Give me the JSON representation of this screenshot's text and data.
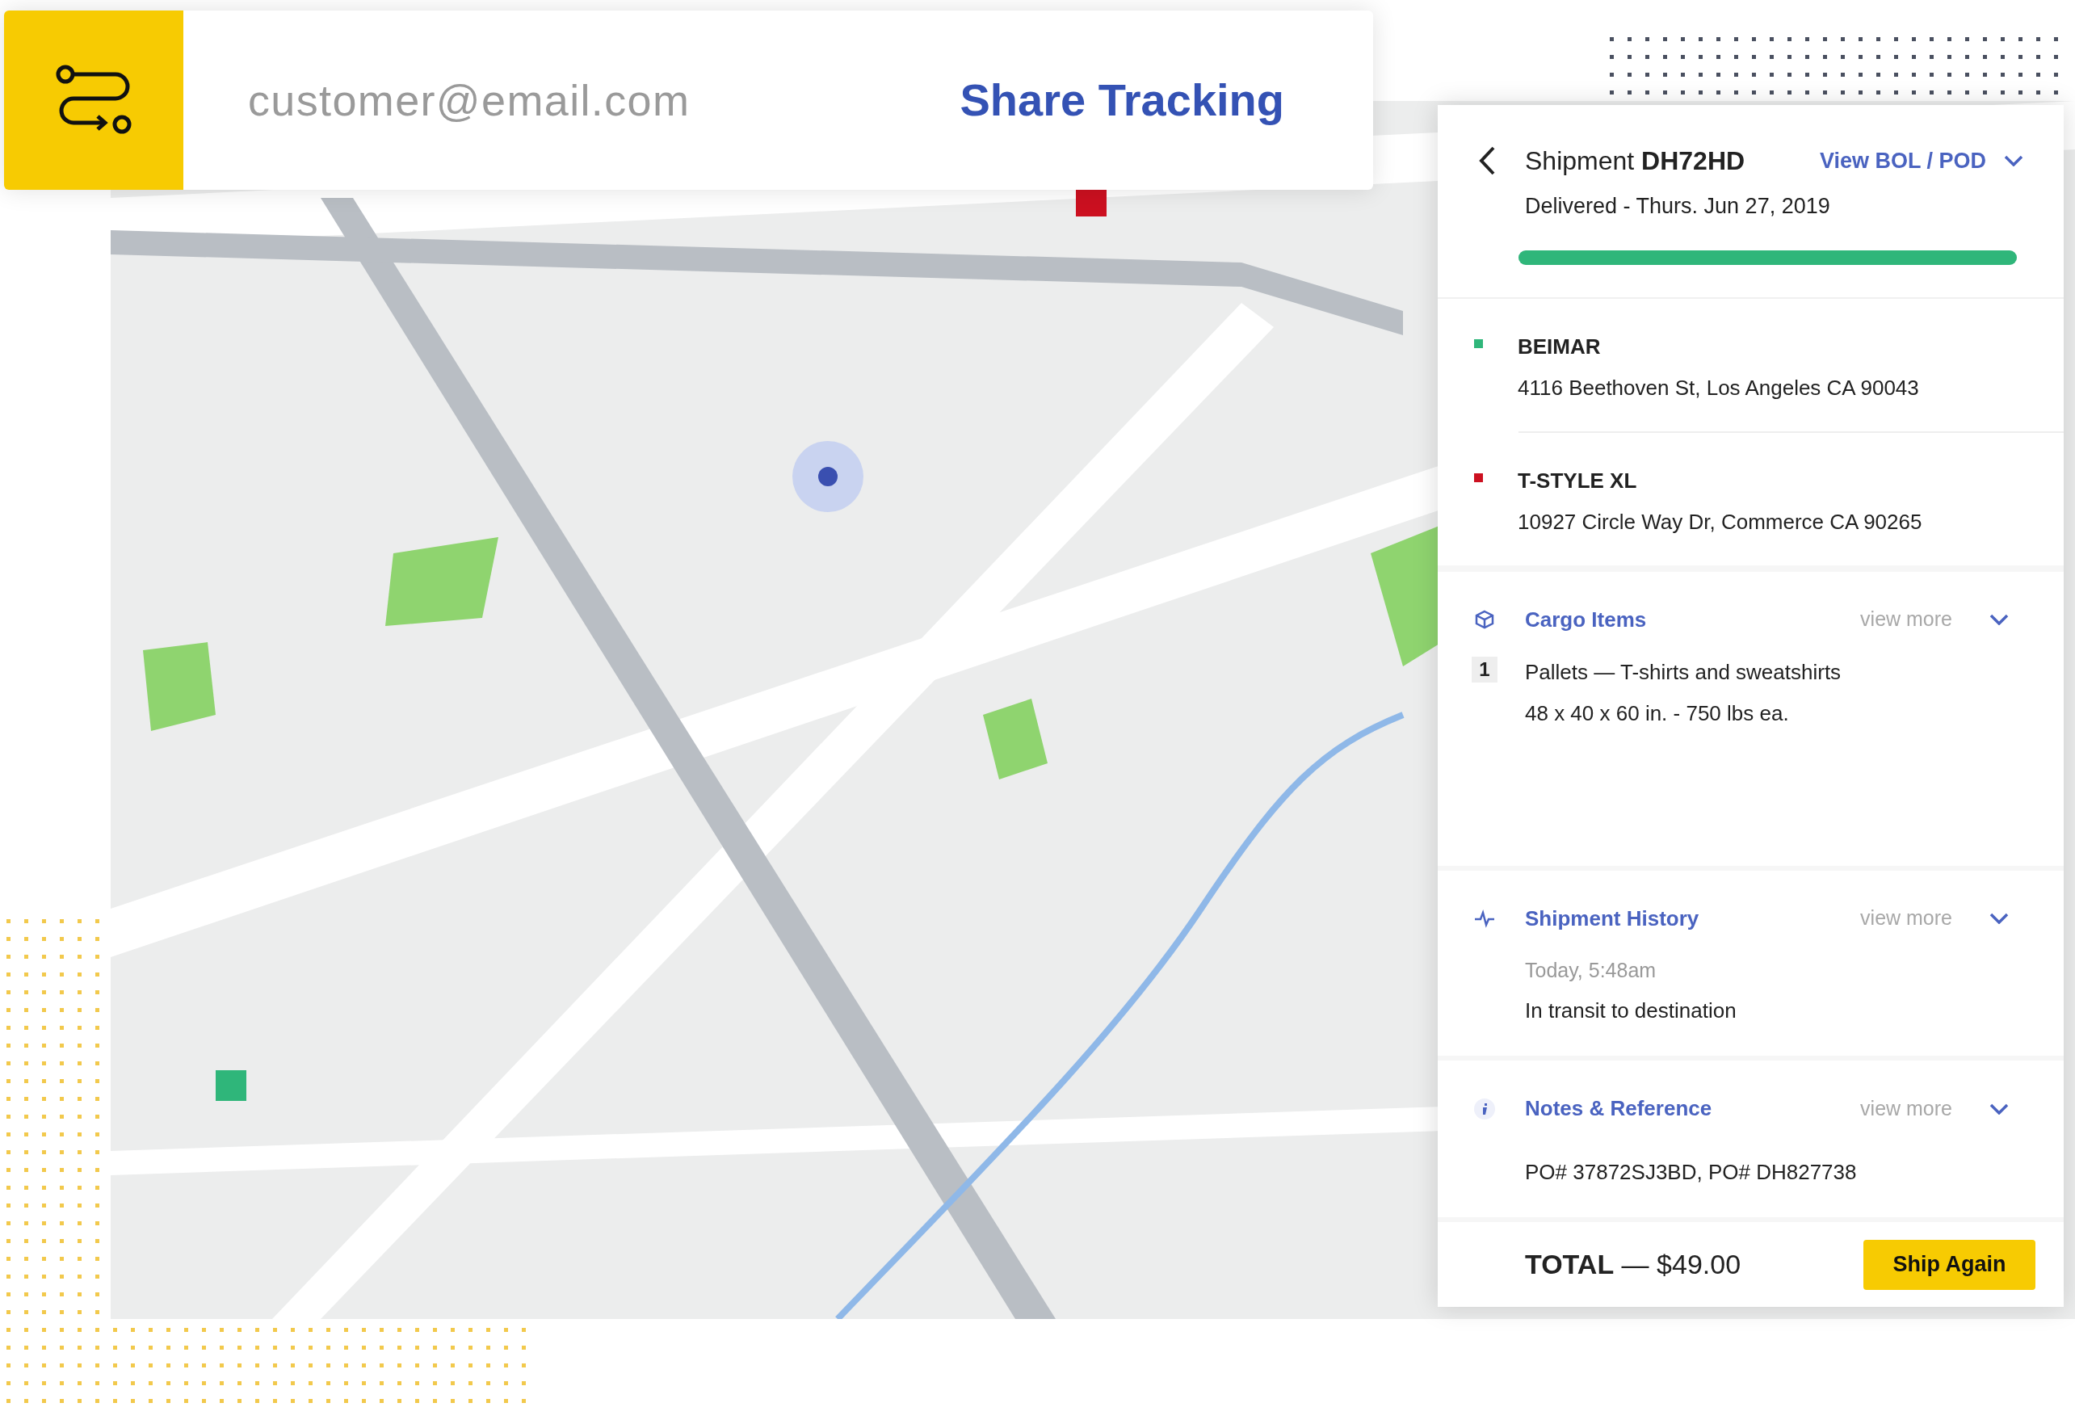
{
  "share_bar": {
    "email": "customer@email.com",
    "action": "Share Tracking"
  },
  "panel": {
    "title": "Shipment **DH72HD**",
    "bol_link": "View BOL / POD",
    "status": "Delivered - Thurs. Jun 27, 2019",
    "progress": {
      "level": 1.0
    },
    "stops": [
      {
        "name": "BEIMAR",
        "address": "4116 Beethoven St, Los Angeles CA 90043",
        "color": "#2fb67a"
      },
      {
        "name": "T-STYLE XL",
        "address": "10927 Circle Way Dr, Commerce CA 90265",
        "color": "#cc1020"
      }
    ],
    "sections": [
      {
        "kind": "cargo",
        "title": "Cargo Items",
        "more": "view more",
        "items": [
          {
            "number": "1",
            "description": "Pallets — T-shirts and sweatshirts",
            "details": "48 x 40 x 60 in. - 750 lbs ea."
          }
        ]
      },
      {
        "kind": "history",
        "title": "Shipment History",
        "more": "view more",
        "time": "Today, 5:48am",
        "event": "In transit to destination"
      },
      {
        "kind": "notes",
        "title": "Notes & Reference",
        "more": "view more",
        "text": "PO# 37872SJ3BD, PO# DH827738"
      }
    ],
    "total": "**TOTAL** — $49.00",
    "button": "Ship Again"
  }
}
